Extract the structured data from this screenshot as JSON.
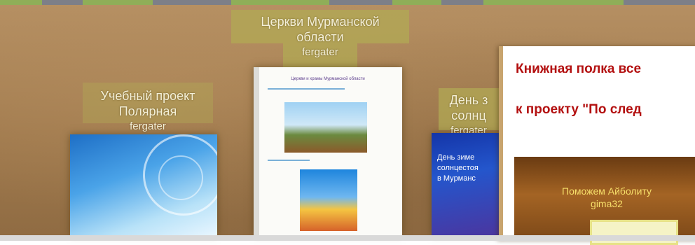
{
  "shelf": {
    "books": [
      {
        "title_lines": [
          "Учебный проект",
          "Полярная"
        ],
        "author": "fergater"
      },
      {
        "title_lines": [
          "Церкви Мурманской",
          "области"
        ],
        "author": "fergater",
        "page_title": "Церкви и храмы Мурманской области"
      },
      {
        "title_lines": [
          "День з",
          "солнц"
        ],
        "author": "fergater",
        "cover_text": [
          "День зиме",
          "солнцестоя",
          "в Мурманс"
        ]
      }
    ]
  },
  "popup": {
    "heading_1": "Книжная полка все",
    "heading_2": "к проекту \"По след",
    "thumb_title": "Поможем Айболиту",
    "thumb_author": "gima32"
  },
  "colors": {
    "heading_red": "#b31010",
    "label_bg": "#b2aa54",
    "wood": "#a07a4e"
  }
}
